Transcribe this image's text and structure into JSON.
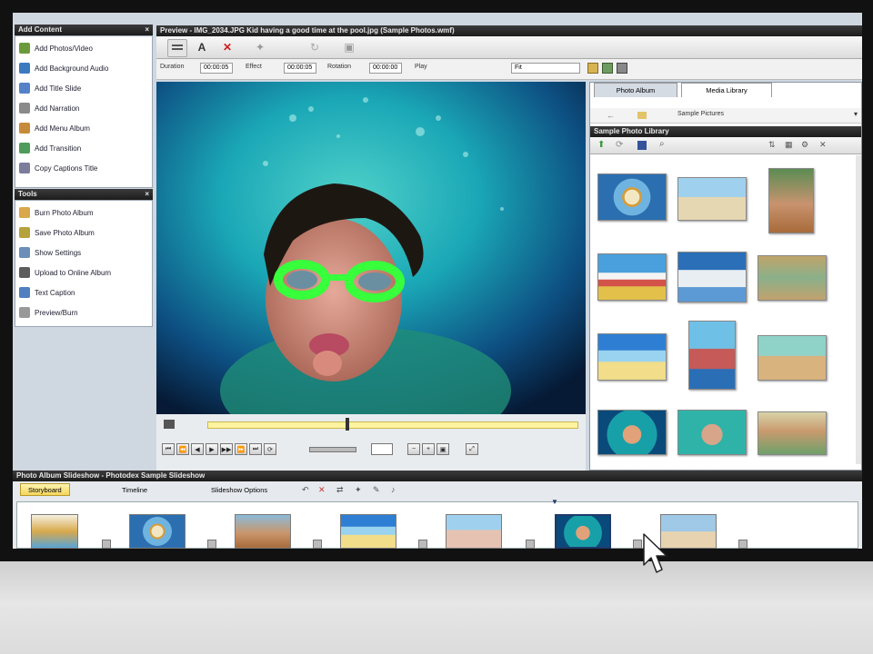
{
  "app": {
    "preview_title": "Preview - IMG_2034.JPG Kid having a good time at the pool.jpg (Sample Photos.wmf)"
  },
  "left_panel": {
    "tasks_title": "Add Content",
    "tasks": [
      {
        "label": "Add Photos/Video",
        "icon": "add-photos-icon"
      },
      {
        "label": "Add Background Audio",
        "icon": "add-audio-icon"
      },
      {
        "label": "Add Title Slide",
        "icon": "title-slide-icon"
      },
      {
        "label": "Add Narration",
        "icon": "narration-icon"
      },
      {
        "label": "Add Menu Album",
        "icon": "menu-album-icon"
      },
      {
        "label": "Add Transition",
        "icon": "transition-icon"
      },
      {
        "label": "Copy Captions Title",
        "icon": "captions-icon"
      }
    ],
    "tools_title": "Tools",
    "tools": [
      {
        "label": "Burn Photo Album",
        "icon": "burn-icon"
      },
      {
        "label": "Save Photo Album",
        "icon": "save-icon"
      },
      {
        "label": "Show Settings",
        "icon": "settings-icon"
      },
      {
        "label": "Upload to Online Album",
        "icon": "upload-icon"
      },
      {
        "label": "Text Caption",
        "icon": "caption-icon"
      },
      {
        "label": "Preview/Burn",
        "icon": "preview-icon"
      }
    ]
  },
  "propbar": {
    "labels": [
      "Duration",
      "Effect",
      "Rotation",
      "Play"
    ],
    "values": [
      "00:00:05",
      "00:00:05",
      "00:00:00",
      "Fit"
    ]
  },
  "browser": {
    "tabs": [
      "Photo Album",
      "Media Library"
    ],
    "path": "Sample Pictures",
    "folder_title": "Sample Photo Library"
  },
  "storyboard": {
    "title": "Photo Album Slideshow - Photodex Sample Slideshow",
    "tabs": [
      "Storyboard",
      "Timeline",
      "Slideshow Options"
    ]
  },
  "colors": {
    "accent": "#ffd84a",
    "selection": "#1e3a6a"
  }
}
